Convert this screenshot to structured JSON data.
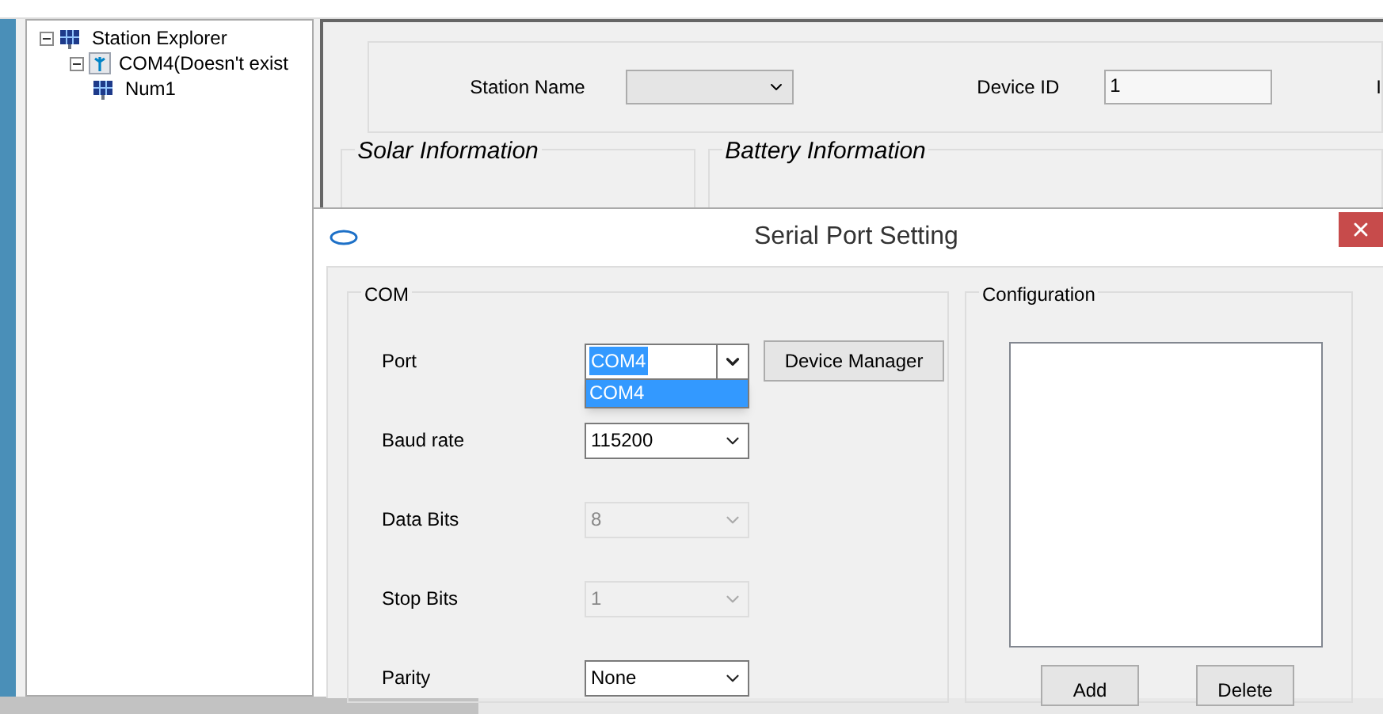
{
  "tree": {
    "label": "Station Explorer",
    "expanded": true,
    "children": [
      {
        "label": "COM4(Doesn't exist",
        "expanded": true,
        "children": [
          {
            "label": "Num1"
          }
        ]
      }
    ]
  },
  "main": {
    "station_name_label": "Station Name",
    "device_id_label": "Device ID",
    "device_id_value": "1",
    "cut_label": "I",
    "groups": [
      "Solar Information",
      "Battery Information"
    ]
  },
  "dialog": {
    "title": "Serial Port Setting",
    "com_group": "COM",
    "fields": [
      {
        "label": "Port",
        "value": "COM4",
        "disabled": false,
        "open": true,
        "options": [
          {
            "label": "COM4",
            "selected": true
          }
        ]
      },
      {
        "label": "Baud rate",
        "value": "115200",
        "disabled": false,
        "open": false
      },
      {
        "label": "Data Bits",
        "value": "8",
        "disabled": true,
        "open": false
      },
      {
        "label": "Stop Bits",
        "value": "1",
        "disabled": true,
        "open": false
      },
      {
        "label": "Parity",
        "value": "None",
        "disabled": false,
        "open": false
      }
    ],
    "device_manager_button": "Device Manager",
    "config_group": "Configuration",
    "buttons": [
      "Add",
      "Delete"
    ]
  }
}
